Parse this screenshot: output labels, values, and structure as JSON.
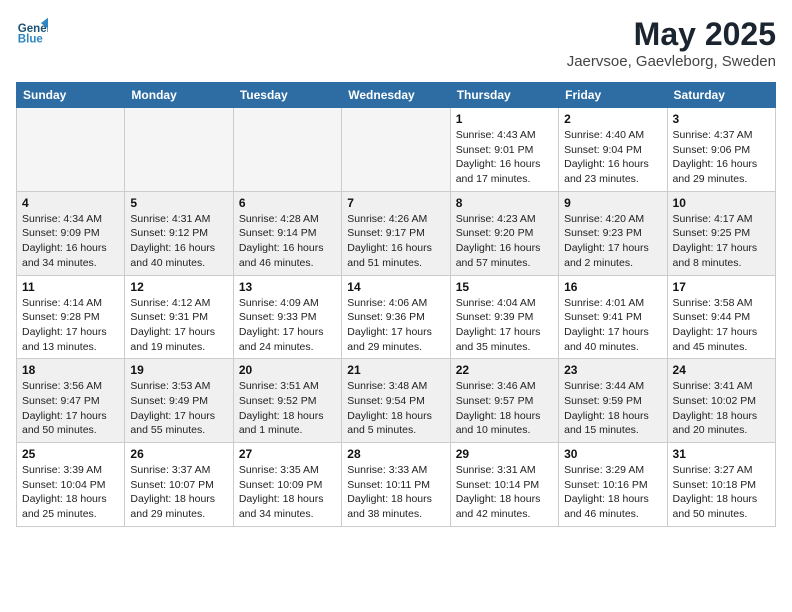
{
  "header": {
    "logo_line1": "General",
    "logo_line2": "Blue",
    "month": "May 2025",
    "location": "Jaervsoe, Gaevleborg, Sweden"
  },
  "columns": [
    "Sunday",
    "Monday",
    "Tuesday",
    "Wednesday",
    "Thursday",
    "Friday",
    "Saturday"
  ],
  "weeks": [
    [
      {
        "day": "",
        "info": ""
      },
      {
        "day": "",
        "info": ""
      },
      {
        "day": "",
        "info": ""
      },
      {
        "day": "",
        "info": ""
      },
      {
        "day": "1",
        "info": "Sunrise: 4:43 AM\nSunset: 9:01 PM\nDaylight: 16 hours\nand 17 minutes."
      },
      {
        "day": "2",
        "info": "Sunrise: 4:40 AM\nSunset: 9:04 PM\nDaylight: 16 hours\nand 23 minutes."
      },
      {
        "day": "3",
        "info": "Sunrise: 4:37 AM\nSunset: 9:06 PM\nDaylight: 16 hours\nand 29 minutes."
      }
    ],
    [
      {
        "day": "4",
        "info": "Sunrise: 4:34 AM\nSunset: 9:09 PM\nDaylight: 16 hours\nand 34 minutes."
      },
      {
        "day": "5",
        "info": "Sunrise: 4:31 AM\nSunset: 9:12 PM\nDaylight: 16 hours\nand 40 minutes."
      },
      {
        "day": "6",
        "info": "Sunrise: 4:28 AM\nSunset: 9:14 PM\nDaylight: 16 hours\nand 46 minutes."
      },
      {
        "day": "7",
        "info": "Sunrise: 4:26 AM\nSunset: 9:17 PM\nDaylight: 16 hours\nand 51 minutes."
      },
      {
        "day": "8",
        "info": "Sunrise: 4:23 AM\nSunset: 9:20 PM\nDaylight: 16 hours\nand 57 minutes."
      },
      {
        "day": "9",
        "info": "Sunrise: 4:20 AM\nSunset: 9:23 PM\nDaylight: 17 hours\nand 2 minutes."
      },
      {
        "day": "10",
        "info": "Sunrise: 4:17 AM\nSunset: 9:25 PM\nDaylight: 17 hours\nand 8 minutes."
      }
    ],
    [
      {
        "day": "11",
        "info": "Sunrise: 4:14 AM\nSunset: 9:28 PM\nDaylight: 17 hours\nand 13 minutes."
      },
      {
        "day": "12",
        "info": "Sunrise: 4:12 AM\nSunset: 9:31 PM\nDaylight: 17 hours\nand 19 minutes."
      },
      {
        "day": "13",
        "info": "Sunrise: 4:09 AM\nSunset: 9:33 PM\nDaylight: 17 hours\nand 24 minutes."
      },
      {
        "day": "14",
        "info": "Sunrise: 4:06 AM\nSunset: 9:36 PM\nDaylight: 17 hours\nand 29 minutes."
      },
      {
        "day": "15",
        "info": "Sunrise: 4:04 AM\nSunset: 9:39 PM\nDaylight: 17 hours\nand 35 minutes."
      },
      {
        "day": "16",
        "info": "Sunrise: 4:01 AM\nSunset: 9:41 PM\nDaylight: 17 hours\nand 40 minutes."
      },
      {
        "day": "17",
        "info": "Sunrise: 3:58 AM\nSunset: 9:44 PM\nDaylight: 17 hours\nand 45 minutes."
      }
    ],
    [
      {
        "day": "18",
        "info": "Sunrise: 3:56 AM\nSunset: 9:47 PM\nDaylight: 17 hours\nand 50 minutes."
      },
      {
        "day": "19",
        "info": "Sunrise: 3:53 AM\nSunset: 9:49 PM\nDaylight: 17 hours\nand 55 minutes."
      },
      {
        "day": "20",
        "info": "Sunrise: 3:51 AM\nSunset: 9:52 PM\nDaylight: 18 hours\nand 1 minute."
      },
      {
        "day": "21",
        "info": "Sunrise: 3:48 AM\nSunset: 9:54 PM\nDaylight: 18 hours\nand 5 minutes."
      },
      {
        "day": "22",
        "info": "Sunrise: 3:46 AM\nSunset: 9:57 PM\nDaylight: 18 hours\nand 10 minutes."
      },
      {
        "day": "23",
        "info": "Sunrise: 3:44 AM\nSunset: 9:59 PM\nDaylight: 18 hours\nand 15 minutes."
      },
      {
        "day": "24",
        "info": "Sunrise: 3:41 AM\nSunset: 10:02 PM\nDaylight: 18 hours\nand 20 minutes."
      }
    ],
    [
      {
        "day": "25",
        "info": "Sunrise: 3:39 AM\nSunset: 10:04 PM\nDaylight: 18 hours\nand 25 minutes."
      },
      {
        "day": "26",
        "info": "Sunrise: 3:37 AM\nSunset: 10:07 PM\nDaylight: 18 hours\nand 29 minutes."
      },
      {
        "day": "27",
        "info": "Sunrise: 3:35 AM\nSunset: 10:09 PM\nDaylight: 18 hours\nand 34 minutes."
      },
      {
        "day": "28",
        "info": "Sunrise: 3:33 AM\nSunset: 10:11 PM\nDaylight: 18 hours\nand 38 minutes."
      },
      {
        "day": "29",
        "info": "Sunrise: 3:31 AM\nSunset: 10:14 PM\nDaylight: 18 hours\nand 42 minutes."
      },
      {
        "day": "30",
        "info": "Sunrise: 3:29 AM\nSunset: 10:16 PM\nDaylight: 18 hours\nand 46 minutes."
      },
      {
        "day": "31",
        "info": "Sunrise: 3:27 AM\nSunset: 10:18 PM\nDaylight: 18 hours\nand 50 minutes."
      }
    ]
  ]
}
